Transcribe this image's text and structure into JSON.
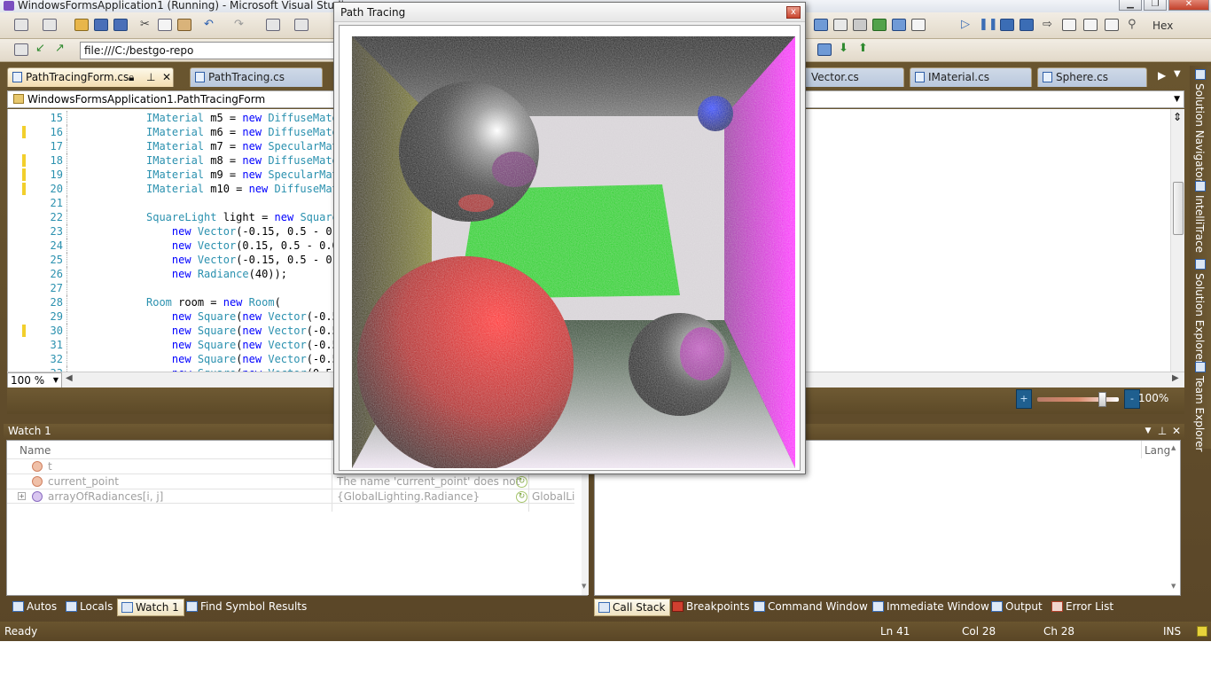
{
  "window": {
    "title": "WindowsFormsApplication1 (Running) - Microsoft Visual Studio"
  },
  "toolbar": {
    "address": "file:///C:/bestgo-repo",
    "hex_label": "Hex"
  },
  "doc_tabs": [
    {
      "label": "PathTracingForm.cs",
      "active": true
    },
    {
      "label": "PathTracing.cs",
      "active": false
    },
    {
      "label": "Vector.cs",
      "active": false
    },
    {
      "label": "IMaterial.cs",
      "active": false
    },
    {
      "label": "Sphere.cs",
      "active": false
    }
  ],
  "editor": {
    "nav_class": "WindowsFormsApplication1.PathTracingForm",
    "zoom": "100 %",
    "zoom_slider_percent": "100%",
    "zoom_slider_level": 0.8,
    "lines": [
      {
        "n": "15",
        "text": "IMaterial m5 = new DiffuseMate",
        "changed": false
      },
      {
        "n": "16",
        "text": "IMaterial m6 = new DiffuseMate",
        "changed": true
      },
      {
        "n": "17",
        "text": "IMaterial m7 = new SpecularMat",
        "changed": false
      },
      {
        "n": "18",
        "text": "IMaterial m8 = new DiffuseMate",
        "changed": true
      },
      {
        "n": "19",
        "text": "IMaterial m9 = new SpecularMat",
        "changed": true
      },
      {
        "n": "20",
        "text": "IMaterial m10 = new DiffuseMat",
        "changed": true
      },
      {
        "n": "21",
        "text": "",
        "changed": false
      },
      {
        "n": "22",
        "text": "SquareLight light = new Square",
        "changed": false
      },
      {
        "n": "23",
        "text": "    new Vector(-0.15, 0.5 - 0.0",
        "changed": false
      },
      {
        "n": "24",
        "text": "    new Vector(0.15, 0.5 - 0.0",
        "changed": false
      },
      {
        "n": "25",
        "text": "    new Vector(-0.15, 0.5 - 0.0",
        "changed": false
      },
      {
        "n": "26",
        "text": "    new Radiance(40));",
        "changed": false
      },
      {
        "n": "27",
        "text": "",
        "changed": false
      },
      {
        "n": "28",
        "text": "Room room = new Room(",
        "changed": false
      },
      {
        "n": "29",
        "text": "    new Square(new Vector(-0.5",
        "changed": false
      },
      {
        "n": "30",
        "text": "    new Square(new Vector(-0.5",
        "changed": true
      },
      {
        "n": "31",
        "text": "    new Square(new Vector(-0.5",
        "changed": false
      },
      {
        "n": "32",
        "text": "    new Square(new Vector(-0.5",
        "changed": false
      },
      {
        "n": "33",
        "text": "    new Square(new Vector(0.5",
        "changed": false
      }
    ]
  },
  "side_pane": {
    "items": [
      "Solution Navigator",
      "IntelliTrace",
      "Solution Explorer",
      "Team Explorer"
    ]
  },
  "watch": {
    "title": "Watch 1",
    "columns": {
      "name": "Name"
    },
    "rows": [
      {
        "name": "t",
        "value": "",
        "type": ""
      },
      {
        "name": "current_point",
        "value": "The name 'current_point' does not exi",
        "type": ""
      },
      {
        "name": "arrayOfRadiances[i, j]",
        "value": "{GlobalLighting.Radiance}",
        "type": "GlobalLi"
      }
    ]
  },
  "callstack": {
    "columns": {
      "lang": "Lang"
    }
  },
  "bottom_tabs_left": [
    {
      "label": "Autos",
      "active": false
    },
    {
      "label": "Locals",
      "active": false
    },
    {
      "label": "Watch 1",
      "active": true
    },
    {
      "label": "Find Symbol Results",
      "active": false
    }
  ],
  "bottom_tabs_right": [
    {
      "label": "Call Stack",
      "active": true
    },
    {
      "label": "Breakpoints",
      "active": false
    },
    {
      "label": "Command Window",
      "active": false
    },
    {
      "label": "Immediate Window",
      "active": false
    },
    {
      "label": "Output",
      "active": false
    },
    {
      "label": "Error List",
      "active": false
    }
  ],
  "status": {
    "state": "Ready",
    "line": "Ln 41",
    "col": "Col 28",
    "ch": "Ch 28",
    "mode": "INS"
  },
  "form": {
    "title": "Path Tracing",
    "close_glyph": "x"
  },
  "colors": {
    "ide_chrome": "#5f4b29",
    "active_tab": "#f3ddb0",
    "keyword": "#0000ff",
    "type": "#2b91af",
    "line_number": "#2b91af",
    "change_marker": "#f2cf2c"
  }
}
